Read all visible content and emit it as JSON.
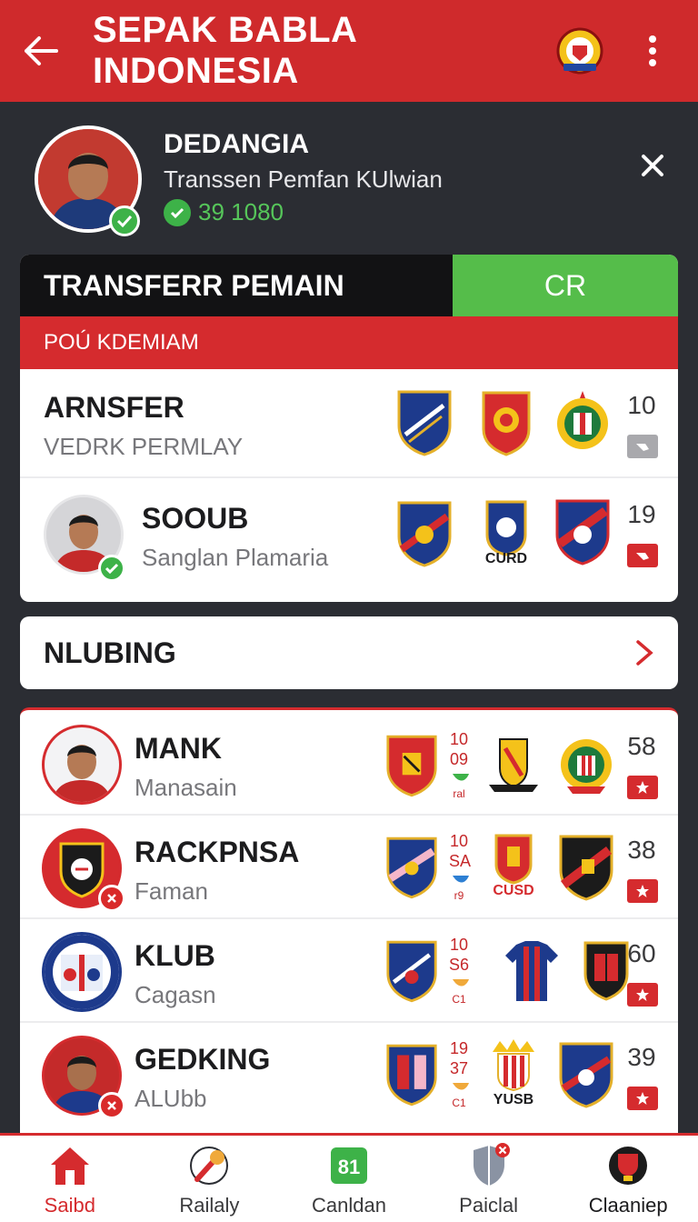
{
  "appbar": {
    "title": "SEPAK BABLA INDONESIA"
  },
  "profile": {
    "name": "DEDANGIA",
    "subtitle": "Transsen Pemfan KUlwian",
    "stat": "39 1080"
  },
  "transfer": {
    "header_label": "TRANSFERR PEMAIN",
    "header_action": "CR",
    "section_label": "POÚ KDEMIAM",
    "rows": [
      {
        "title": "ARNSFER",
        "subtitle": "VEDRK PERMLAY",
        "number": "10"
      },
      {
        "title": "SOOUB",
        "subtitle": "Sanglan Plamaria",
        "number": "19",
        "crest_caption": "CURD"
      }
    ]
  },
  "nav_item": {
    "label": "NLUBING"
  },
  "clubs": [
    {
      "title": "MANK",
      "subtitle": "Manasain",
      "number": "58",
      "mini": [
        "10",
        "09",
        "ral"
      ]
    },
    {
      "title": "RACKPNSA",
      "subtitle": "Faman",
      "number": "38",
      "mini": [
        "10",
        "SA",
        "r9"
      ],
      "crest_caption": "CUSD"
    },
    {
      "title": "KLUB",
      "subtitle": "Cagasn",
      "number": "60",
      "mini": [
        "10",
        "S6",
        "C1"
      ]
    },
    {
      "title": "GEDKING",
      "subtitle": "ALUbb",
      "number": "39",
      "mini": [
        "19",
        "37",
        "C1"
      ],
      "crest_caption": "YUSB"
    }
  ],
  "bottom_nav": [
    {
      "label": "Saibd",
      "icon": "home-icon",
      "active": true
    },
    {
      "label": "Railaly",
      "icon": "microphone-icon"
    },
    {
      "label": "Canldan",
      "icon": "scoreboard-icon",
      "badge": "81"
    },
    {
      "label": "Paiclal",
      "icon": "shield-icon"
    },
    {
      "label": "Claaniep",
      "icon": "trophy-icon"
    }
  ],
  "colors": {
    "primary_red": "#cf2a2c",
    "green": "#55bd4a",
    "dark_bg": "#2b2d33"
  }
}
